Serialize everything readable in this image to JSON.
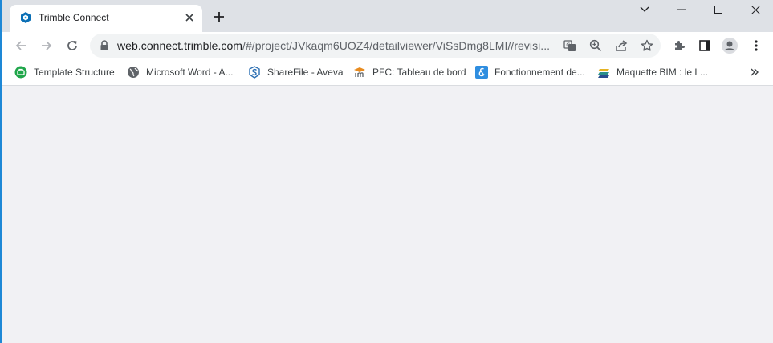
{
  "tab": {
    "title": "Trimble Connect",
    "favicon": "trimble-connect-icon"
  },
  "window_controls": [
    "chevron-down-icon",
    "minimize-icon",
    "maximize-icon",
    "close-icon"
  ],
  "address_bar": {
    "host": "web.connect.trimble.com",
    "path": "/#/project/JVkaqm6UOZ4/detailviewer/ViSsDmg8LMI//revisi...",
    "icons": [
      "translate-icon",
      "zoom-icon",
      "share-icon",
      "bookmark-star-icon"
    ]
  },
  "toolbar_icons": [
    "extensions-icon",
    "side-panel-icon",
    "profile-icon",
    "menu-icon"
  ],
  "bookmarks": [
    {
      "label": "Template Structure",
      "icon": "template-structure-icon"
    },
    {
      "label": "Microsoft Word - A...",
      "icon": "globe-icon"
    },
    {
      "label": "ShareFile - Aveva",
      "icon": "sharefile-icon"
    },
    {
      "label": "PFC: Tableau de bord",
      "icon": "pfc-icon"
    },
    {
      "label": "Fonctionnement de...",
      "icon": "fonctionnement-icon"
    },
    {
      "label": "Maquette BIM : le L...",
      "icon": "maquette-bim-icon"
    }
  ],
  "colors": {
    "tabstrip": "#dee1e6",
    "content": "#f1f1f4",
    "accent": "#1e88d6"
  }
}
